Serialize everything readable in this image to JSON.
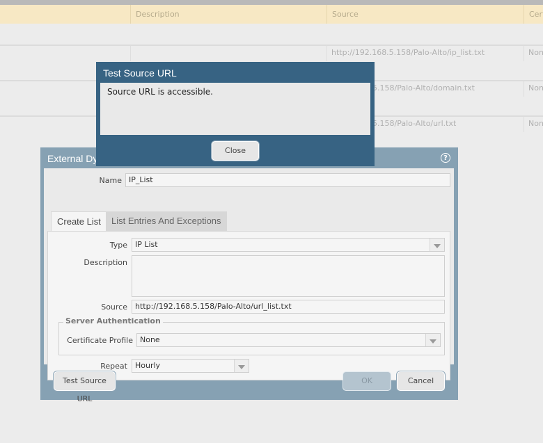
{
  "table": {
    "headers": {
      "description": "Description",
      "source": "Source",
      "certificate": "Certi"
    },
    "rows": [
      {
        "source": "http://192.168.5.158/Palo-Alto/ip_list.txt",
        "cert": "None"
      },
      {
        "source": "5.158/Palo-Alto/domain.txt",
        "cert": "None"
      },
      {
        "source": "5.158/Palo-Alto/url.txt",
        "cert": "None"
      }
    ]
  },
  "dialog": {
    "title": "External Dyna",
    "name_label": "Name",
    "name_value": "IP_List",
    "tabs": [
      {
        "label": "Create List",
        "active": true
      },
      {
        "label": "List Entries And Exceptions",
        "active": false
      }
    ],
    "type_label": "Type",
    "type_value": "IP List",
    "description_label": "Description",
    "description_value": "",
    "source_label": "Source",
    "source_value": "http://192.168.5.158/Palo-Alto/url_list.txt",
    "server_auth_legend": "Server Authentication",
    "cert_profile_label": "Certificate Profile",
    "cert_profile_value": "None",
    "repeat_label": "Repeat",
    "repeat_value": "Hourly",
    "test_button": "Test Source URL",
    "ok_button": "OK",
    "cancel_button": "Cancel",
    "help_icon": "?"
  },
  "popup": {
    "title": "Test Source URL",
    "message": "Source URL is accessible.",
    "close_button": "Close"
  },
  "icons": {
    "help": "question-circle-icon",
    "dropdown": "chevron-down-icon"
  },
  "colors": {
    "dialog_frame": "#86a1b3",
    "popup_frame": "#376383",
    "header_bg": "#f7e8c4"
  }
}
